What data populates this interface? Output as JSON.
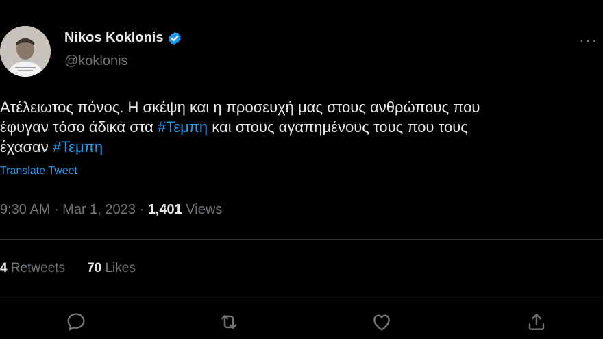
{
  "author": {
    "name": "Nikos Koklonis",
    "handle": "@koklonis"
  },
  "tweet": {
    "line1": "Ατέλειωτος πόνος. Η σκέψη και η προσευχή μας στους ανθρώπους που",
    "line2a": "έφυγαν τόσο άδικα στα ",
    "hashtag1": "#Τεμπη",
    "line2b": " και στους αγαπημένους τους που τους",
    "line3a": "έχασαν ",
    "hashtag2": "#Τεμπη",
    "translate_label": "Translate Tweet"
  },
  "meta": {
    "time": "9:30 AM",
    "sep1": " · ",
    "date": "Mar 1, 2023",
    "sep2": " · ",
    "views_count": "1,401",
    "views_label": " Views"
  },
  "stats": {
    "retweets_count": "4",
    "retweets_label": " Retweets",
    "likes_count": "70",
    "likes_label": " Likes"
  },
  "icons": {
    "more": "more-icon",
    "verified": "verified-badge-icon",
    "reply": "reply-icon",
    "retweet": "retweet-icon",
    "like": "like-icon",
    "share": "share-icon"
  },
  "colors": {
    "background": "#000000",
    "text": "#e7e9ea",
    "secondary": "#71767b",
    "accent": "#1d9bf0"
  }
}
